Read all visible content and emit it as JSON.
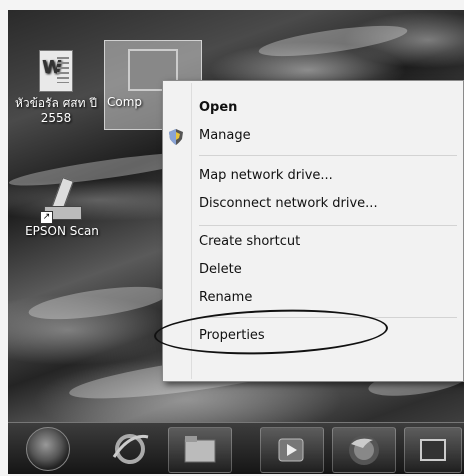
{
  "desktop": {
    "icons": [
      {
        "label": "หัวข้อรัล ศสท ปี 2558",
        "icon": "word-document-icon"
      },
      {
        "label": "Comp",
        "icon": "computer-icon"
      },
      {
        "label": "EPSON Scan",
        "icon": "scanner-icon"
      }
    ]
  },
  "context_menu": {
    "items": [
      {
        "label": "Open",
        "bold": true
      },
      {
        "label": "Manage",
        "icon": "uac-shield-icon"
      },
      {
        "label": "Map network drive..."
      },
      {
        "label": "Disconnect network drive..."
      },
      {
        "label": "Create shortcut"
      },
      {
        "label": "Delete"
      },
      {
        "label": "Rename"
      },
      {
        "label": "Properties",
        "highlighted_by": "hand-drawn-ellipse"
      }
    ]
  },
  "taskbar": {
    "items": [
      "start-orb-icon",
      "internet-explorer-icon",
      "file-explorer-icon",
      "media-player-icon",
      "firefox-icon",
      "window-icon"
    ]
  }
}
